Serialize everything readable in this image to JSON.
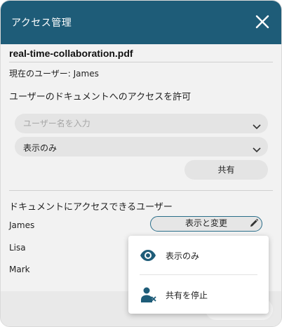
{
  "dialog": {
    "title": "アクセス管理",
    "filename": "real-time-collaboration.pdf",
    "current_user": "現在のユーザー: James",
    "grant_section_title": "ユーザーのドキュメントへのアクセスを許可",
    "username_input": {
      "placeholder": "ユーザー名を入力",
      "value": ""
    },
    "permission_select": {
      "value": "表示のみ"
    },
    "share_button": "共有",
    "users_section_title": "ドキュメントにアクセスできるユーザー",
    "users": [
      {
        "name": "James",
        "permission": "表示と変更"
      },
      {
        "name": "Lisa"
      },
      {
        "name": "Mark"
      }
    ]
  },
  "dropdown_menu": {
    "items": [
      {
        "label": "表示のみ",
        "icon": "eye-icon"
      },
      {
        "label": "共有を停止",
        "icon": "user-remove-icon"
      }
    ]
  },
  "colors": {
    "header": "#1e5c78",
    "accent_border": "#2a6e8a",
    "menu_icon": "#1e5c78"
  }
}
